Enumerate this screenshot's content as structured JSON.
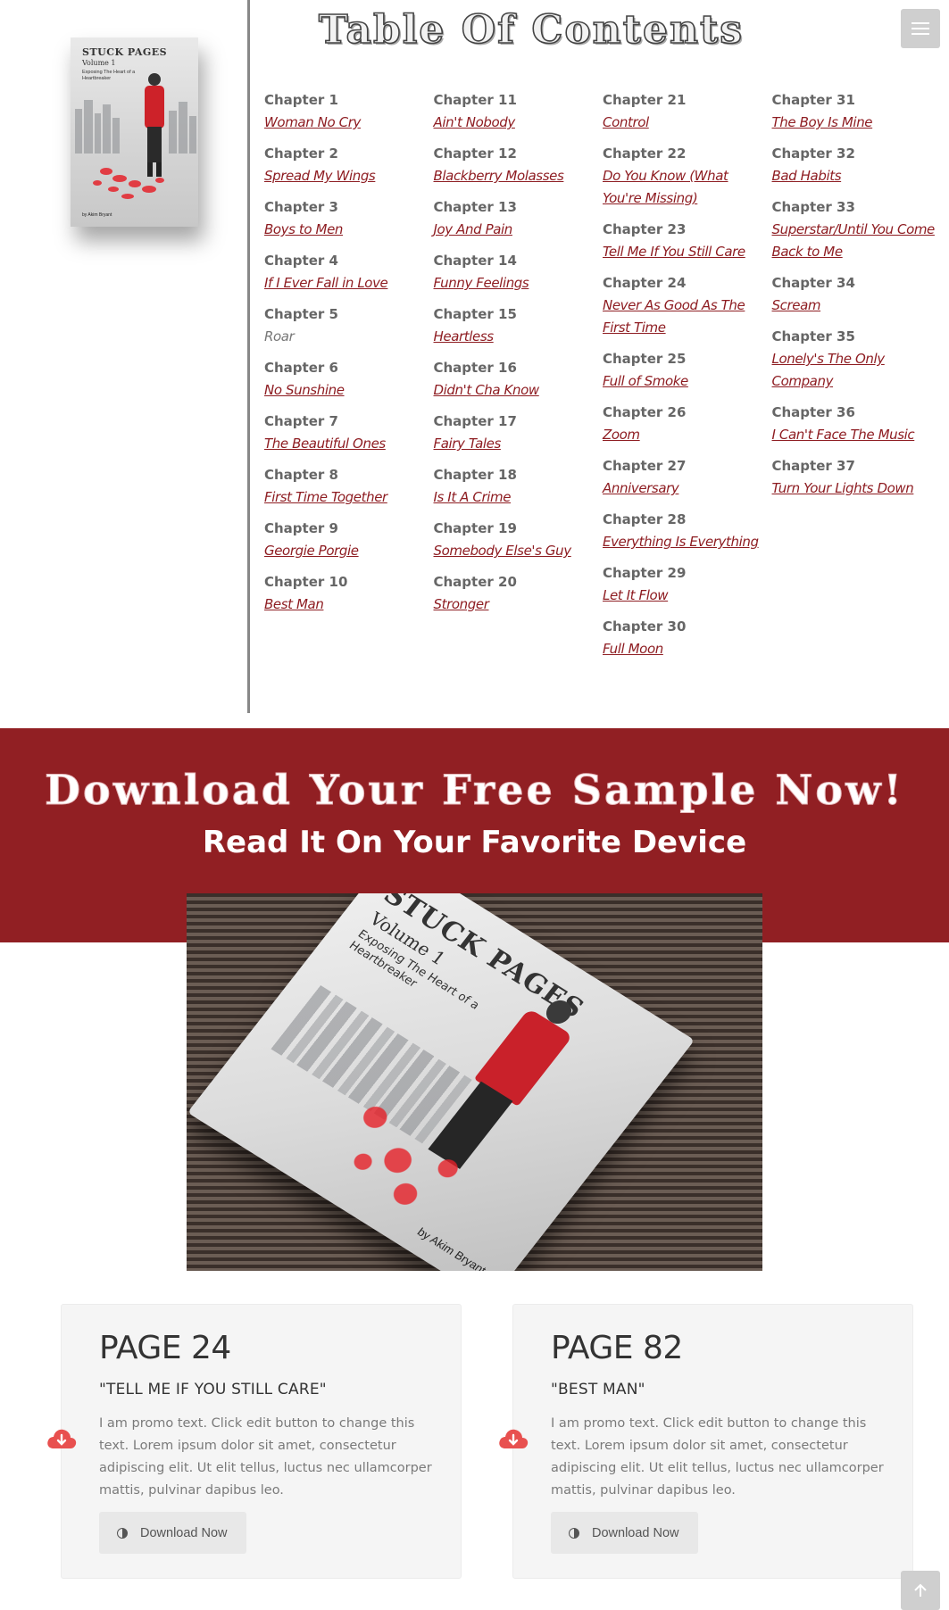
{
  "header": {
    "title": "Table Of Contents"
  },
  "cover_small": {
    "title": "STUCK PAGES",
    "volume": "Volume 1",
    "subtitle": "Exposing The Heart of a Heartbreaker",
    "author": "by Akim Bryant"
  },
  "toc": {
    "columns": [
      [
        {
          "num": "Chapter 1",
          "name": "Woman No Cry",
          "link": true
        },
        {
          "num": "Chapter 2",
          "name": "Spread My Wings",
          "link": true
        },
        {
          "num": "Chapter 3",
          "name": "Boys to Men",
          "link": true
        },
        {
          "num": "Chapter 4",
          "name": "If I Ever Fall in Love",
          "link": true
        },
        {
          "num": "Chapter 5",
          "name": "Roar",
          "link": false
        },
        {
          "num": "Chapter 6",
          "name": "No Sunshine",
          "link": true
        },
        {
          "num": "Chapter 7",
          "name": "The Beautiful Ones",
          "link": true
        },
        {
          "num": "Chapter 8",
          "name": "First Time Together",
          "link": true
        },
        {
          "num": "Chapter 9",
          "name": "Georgie Porgie",
          "link": true
        },
        {
          "num": "Chapter 10",
          "name": "Best Man",
          "link": true
        }
      ],
      [
        {
          "num": "Chapter 11",
          "name": "Ain't Nobody",
          "link": true
        },
        {
          "num": "Chapter 12",
          "name": "Blackberry Molasses",
          "link": true
        },
        {
          "num": "Chapter 13",
          "name": "Joy And Pain",
          "link": true
        },
        {
          "num": "Chapter 14",
          "name": "Funny Feelings",
          "link": true
        },
        {
          "num": "Chapter 15",
          "name": "Heartless",
          "link": true
        },
        {
          "num": "Chapter 16",
          "name": "Didn't Cha Know",
          "link": true
        },
        {
          "num": "Chapter 17",
          "name": "Fairy Tales",
          "link": true
        },
        {
          "num": "Chapter 18",
          "name": "Is It A Crime",
          "link": true
        },
        {
          "num": "Chapter 19",
          "name": "Somebody Else's Guy",
          "link": true
        },
        {
          "num": "Chapter 20",
          "name": "Stronger",
          "link": true
        }
      ],
      [
        {
          "num": "Chapter 21",
          "name": "Control",
          "link": true
        },
        {
          "num": "Chapter 22",
          "name": "Do You Know (What You're Missing)",
          "link": true
        },
        {
          "num": "Chapter 23",
          "name": "Tell Me If You Still Care",
          "link": true
        },
        {
          "num": "Chapter 24",
          "name": "Never As Good As The First Time",
          "link": true
        },
        {
          "num": "Chapter 25",
          "name": "Full of Smoke",
          "link": true
        },
        {
          "num": "Chapter 26",
          "name": "Zoom",
          "link": true
        },
        {
          "num": "Chapter 27",
          "name": "Anniversary",
          "link": true
        },
        {
          "num": "Chapter 28",
          "name": "Everything Is Everything",
          "link": true
        },
        {
          "num": "Chapter 29",
          "name": "Let It Flow",
          "link": true
        },
        {
          "num": "Chapter 30",
          "name": "Full Moon",
          "link": true
        }
      ],
      [
        {
          "num": "Chapter 31",
          "name": "The Boy Is Mine",
          "link": true
        },
        {
          "num": "Chapter 32",
          "name": "Bad Habits",
          "link": true
        },
        {
          "num": "Chapter 33",
          "name": "Superstar/Until You Come Back to Me",
          "link": true
        },
        {
          "num": "Chapter 34",
          "name": "Scream",
          "link": true
        },
        {
          "num": "Chapter 35",
          "name": "Lonely's The Only Company",
          "link": true
        },
        {
          "num": "Chapter 36",
          "name": "I Can't Face The Music",
          "link": true
        },
        {
          "num": "Chapter 37",
          "name": "Turn Your Lights Down",
          "link": true
        }
      ]
    ]
  },
  "band": {
    "title": "Download Your Free Sample Now!",
    "subtitle": "Read It On Your Favorite Device"
  },
  "big_book": {
    "title": "STUCK PAGES",
    "volume": "Volume 1",
    "subtitle": "Exposing The Heart of a Heartbreaker",
    "author": "by Akim Bryant"
  },
  "cards": [
    {
      "page": "PAGE 24",
      "song": "\"TELL ME IF YOU STILL CARE\"",
      "promo": "I am promo text. Click edit button to change this text. Lorem ipsum dolor sit amet, consectetur adipiscing elit. Ut elit tellus, luctus nec ullamcorper mattis, pulvinar dapibus leo.",
      "button": "Download Now"
    },
    {
      "page": "PAGE 82",
      "song": "\"BEST MAN\"",
      "promo": "I am promo text. Click edit button to change this text. Lorem ipsum dolor sit amet, consectetur adipiscing elit. Ut elit tellus, luctus nec ullamcorper mattis, pulvinar dapibus leo.",
      "button": "Download Now"
    }
  ],
  "icons": {
    "menu": "hamburger-menu-icon",
    "cloud": "cloud-download-icon",
    "contrast": "half-circle-icon",
    "scroll_top": "arrow-up-icon"
  },
  "colors": {
    "accent": "#911f23",
    "link": "#8e1d22",
    "cloud": "#e8504f"
  }
}
